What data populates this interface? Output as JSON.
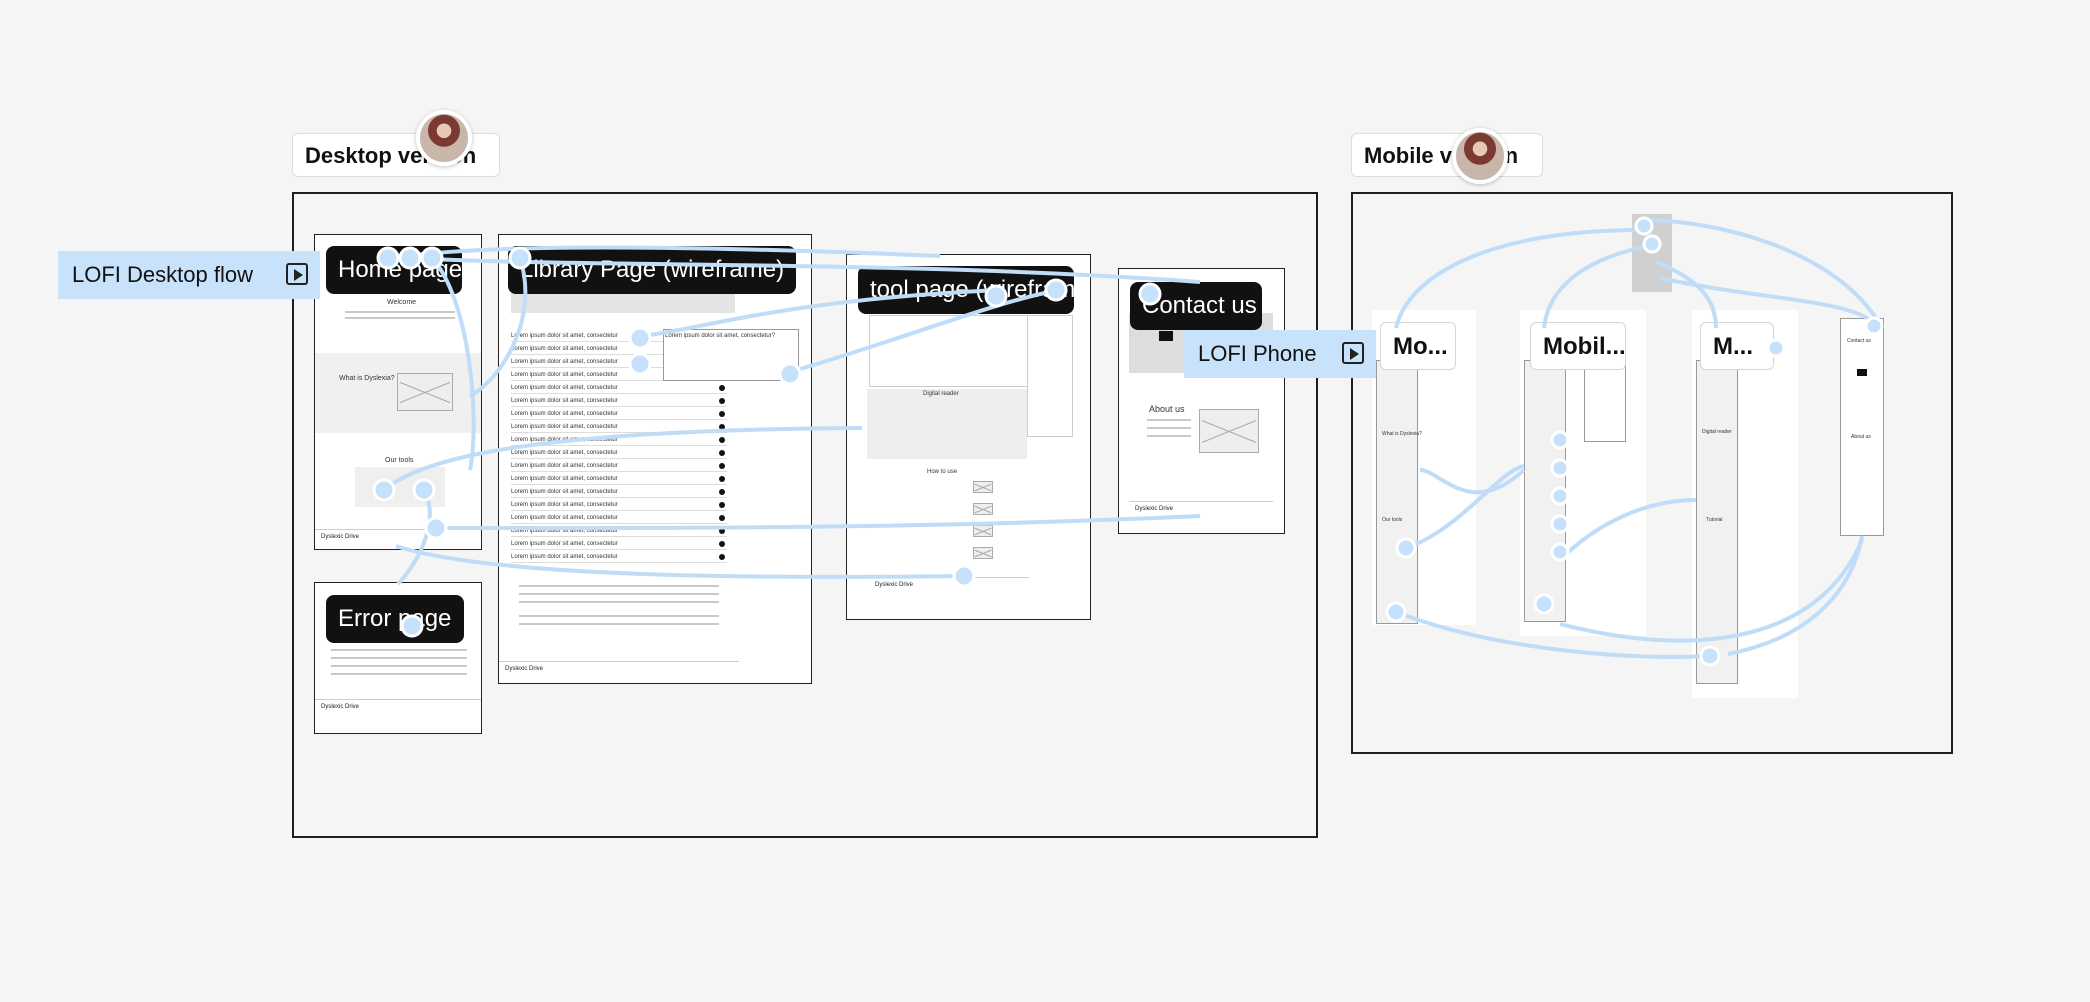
{
  "sections": {
    "desktop_label": "Desktop version",
    "mobile_label": "Mobile version"
  },
  "flows": {
    "desktop_flow_label": "LOFI Desktop flow",
    "phone_flow_label": "LOFI Phone"
  },
  "desktop_frames": {
    "home": "Home page",
    "library": "Library Page (wireframe)",
    "tool": "tool page (wireframe)",
    "contact": "Contact us",
    "error": "Error page"
  },
  "mobile_frames": {
    "mo1": "Mo...",
    "mo2": "Mobil...",
    "mo3": "M..."
  },
  "wireframe_text": {
    "welcome": "Welcome",
    "what_is": "What is Dyslexia?",
    "our_tools": "Our tools",
    "brand": "Dyslexic Drive",
    "lorem_row": "Lorem ipsum dolor sit amet, consectetur",
    "lorem_question": "Lorem ipsum dolor sit amet, consectetur?",
    "digital_reader": "Digital reader",
    "how_to_use": "How to use",
    "about_us": "About us",
    "tutorial": "Tutorial",
    "contact_us": "Contact us"
  },
  "colors": {
    "connector": "#bfdcf8",
    "frame_title_bg": "#111111",
    "canvas_bg": "#f5f5f5"
  }
}
